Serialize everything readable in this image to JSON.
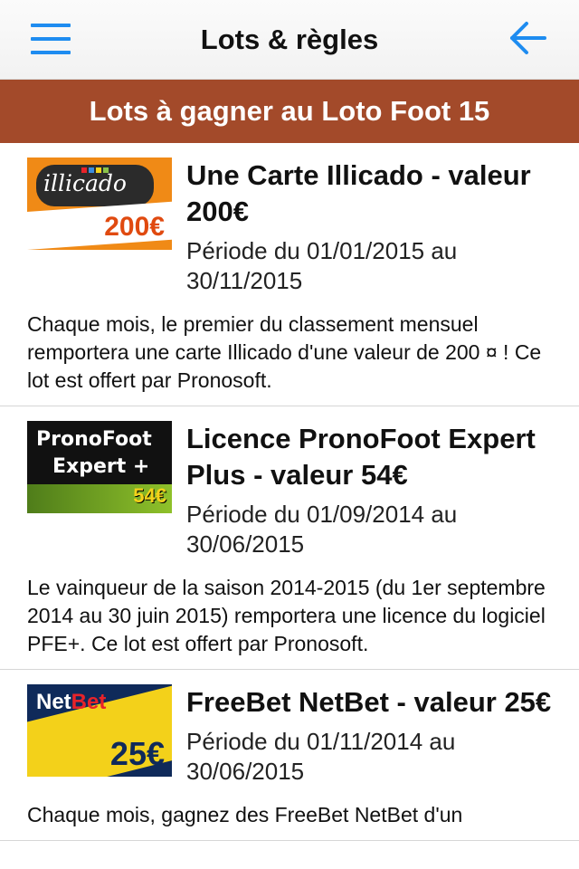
{
  "navbar": {
    "title": "Lots & règles"
  },
  "section": {
    "header": "Lots à gagner au Loto Foot 15"
  },
  "prizes": [
    {
      "title": "Une Carte Illicado - valeur 200€",
      "period": "Période du 01/01/2015 au 30/11/2015",
      "description": "Chaque mois, le premier du classement mensuel remportera une carte Illicado d'une valeur de 200 ¤ ! Ce lot est offert par Pronosoft.",
      "image": {
        "brand": "illicado",
        "amount": "200€"
      }
    },
    {
      "title": "Licence PronoFoot Expert Plus - valeur 54€",
      "period": "Période du 01/09/2014 au 30/06/2015",
      "description": "Le vainqueur de la saison 2014-2015 (du 1er septembre 2014 au 30 juin 2015) remportera une licence du logiciel PFE+. Ce lot est offert par Pronosoft.",
      "image": {
        "line1": "PronoFoot",
        "line2": "Expert +",
        "amount": "54€"
      }
    },
    {
      "title": "FreeBet NetBet - valeur 25€",
      "period": "Période du 01/11/2014 au 30/06/2015",
      "description": "Chaque mois, gagnez des FreeBet NetBet d'un",
      "image": {
        "brand_a": "Net",
        "brand_b": "Bet",
        "amount": "25€"
      }
    }
  ],
  "colors": {
    "accent": "#1e8cf0",
    "header_bg": "#a34a2a",
    "navbar_bg": "#f5f5f5"
  }
}
